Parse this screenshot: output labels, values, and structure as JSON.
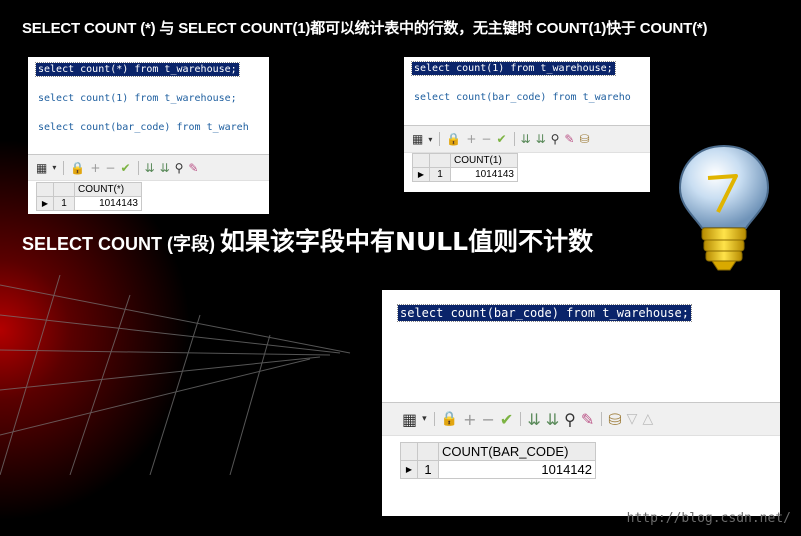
{
  "headlines": {
    "line1": "SELECT COUNT (*) 与 SELECT COUNT(1)都可以统计表中的行数，无主键时 COUNT(1)快于 COUNT(*)",
    "line2_small": "SELECT COUNT (字段)",
    "line2_big": "如果该字段中有NULL值则不计数"
  },
  "panels": {
    "panel1": {
      "sql_lines": [
        "select count(*) from t_warehouse;",
        "select count(1) from t_warehouse;",
        "select count(bar_code) from t_wareh"
      ],
      "result_header": "COUNT(*)",
      "row_number": "1",
      "row_value": "1014143"
    },
    "panel2": {
      "sql_lines": [
        "select count(1) from t_warehouse;",
        "select count(bar_code) from t_wareho"
      ],
      "result_header": "COUNT(1)",
      "row_number": "1",
      "row_value": "1014143"
    },
    "panel3": {
      "sql_lines": [
        "select count(bar_code) from t_warehouse;"
      ],
      "result_header": "COUNT(BAR_CODE)",
      "row_number": "1",
      "row_value": "1014142"
    }
  },
  "toolbar_icons": [
    "grid-layout-icon",
    "dropdown-arrow-icon",
    "lock-icon",
    "add-icon",
    "remove-icon",
    "check-icon",
    "sort-down-icon",
    "sort-down-alt-icon",
    "binoculars-icon",
    "eraser-icon"
  ],
  "watermark": "http://blog.csdn.net/",
  "colors": {
    "selection": "#0a246a",
    "sql_text": "#2060a0",
    "accent_red": "#b30000"
  }
}
